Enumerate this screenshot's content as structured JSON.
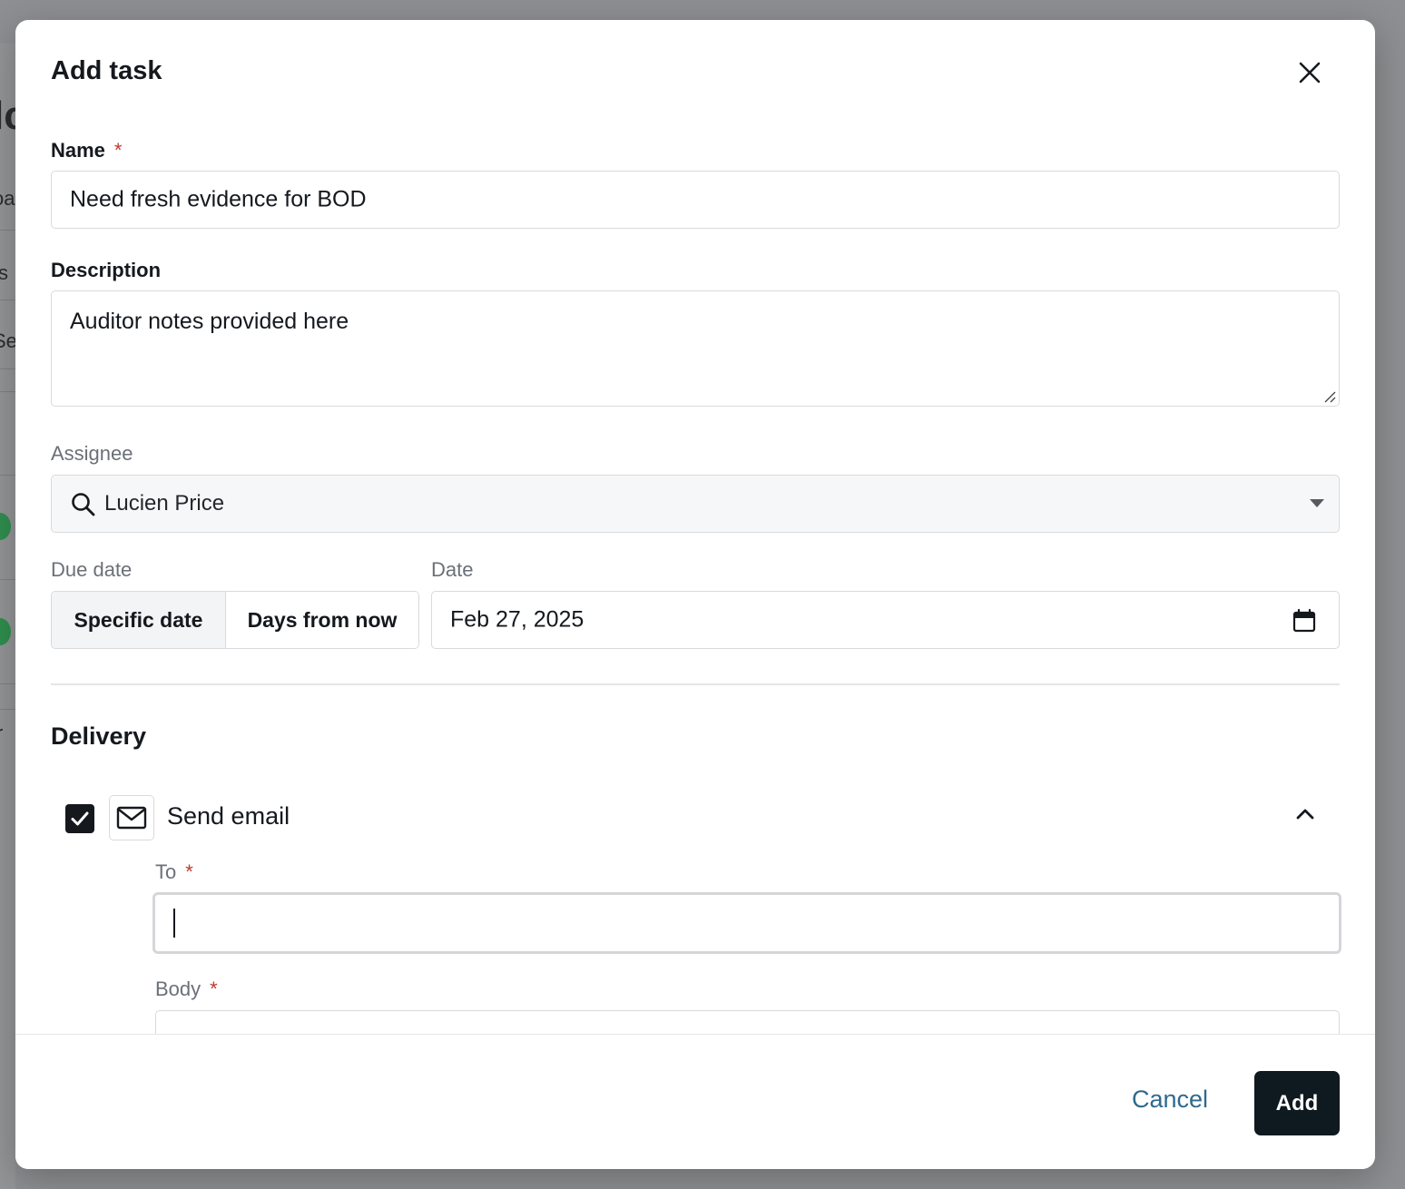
{
  "background": {
    "fragments": [
      "lc",
      "oa",
      "s",
      "Se",
      "r"
    ]
  },
  "modal": {
    "title": "Add task"
  },
  "form": {
    "name": {
      "label": "Name",
      "required_mark": "*",
      "value": "Need fresh evidence for BOD"
    },
    "description": {
      "label": "Description",
      "value": "Auditor notes provided here"
    },
    "assignee": {
      "label": "Assignee",
      "value": "Lucien Price"
    },
    "due_date": {
      "label": "Due date",
      "options": [
        "Specific date",
        "Days from now"
      ],
      "selected": "Specific date"
    },
    "date": {
      "label": "Date",
      "value": "Feb 27, 2025"
    }
  },
  "delivery": {
    "title": "Delivery",
    "send_email": {
      "label": "Send email",
      "checked": true,
      "to": {
        "label": "To",
        "required_mark": "*",
        "value": ""
      },
      "body": {
        "label": "Body",
        "required_mark": "*"
      }
    }
  },
  "footer": {
    "cancel_label": "Cancel",
    "add_label": "Add"
  },
  "colors": {
    "primary_button": "#0f1a20",
    "link": "#2d6a8e",
    "required": "#c0392b"
  }
}
